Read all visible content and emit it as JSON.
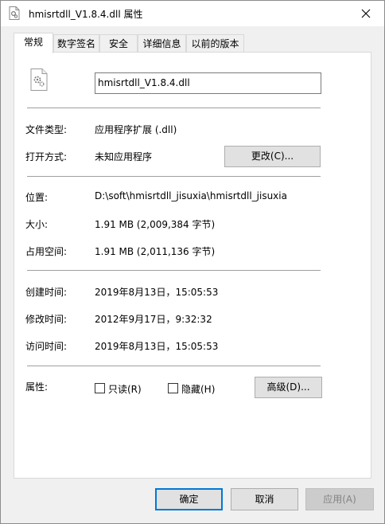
{
  "window": {
    "title": "hmisrtdll_V1.8.4.dll 属性"
  },
  "tabs": [
    {
      "label": "常规",
      "active": true
    },
    {
      "label": "数字签名",
      "active": false
    },
    {
      "label": "安全",
      "active": false
    },
    {
      "label": "详细信息",
      "active": false
    },
    {
      "label": "以前的版本",
      "active": false
    }
  ],
  "general": {
    "file_name": "hmisrtdll_V1.8.4.dll",
    "file_type_label": "文件类型:",
    "file_type_value": "应用程序扩展 (.dll)",
    "opens_with_label": "打开方式:",
    "opens_with_value": "未知应用程序",
    "change_button": "更改(C)...",
    "location_label": "位置:",
    "location_value": "D:\\soft\\hmisrtdll_jisuxia\\hmisrtdll_jisuxia",
    "size_label": "大小:",
    "size_value": "1.91 MB (2,009,384 字节)",
    "size_on_disk_label": "占用空间:",
    "size_on_disk_value": "1.91 MB (2,011,136 字节)",
    "created_label": "创建时间:",
    "created_value": "2019年8月13日，15:05:53",
    "modified_label": "修改时间:",
    "modified_value": "2012年9月17日，9:32:32",
    "accessed_label": "访问时间:",
    "accessed_value": "2019年8月13日，15:05:53",
    "attributes_label": "属性:",
    "readonly_label": "只读(R)",
    "readonly_checked": false,
    "hidden_label": "隐藏(H)",
    "hidden_checked": false,
    "advanced_button": "高级(D)..."
  },
  "footer": {
    "ok_button": "确定",
    "cancel_button": "取消",
    "apply_button": "应用(A)"
  },
  "icons": {
    "title": "dll-file-icon",
    "file": "dll-file-gear-icon",
    "close": "close-icon"
  },
  "colors": {
    "accent": "#0078d7",
    "window_bg": "#f0f0f0",
    "panel_bg": "#ffffff"
  }
}
